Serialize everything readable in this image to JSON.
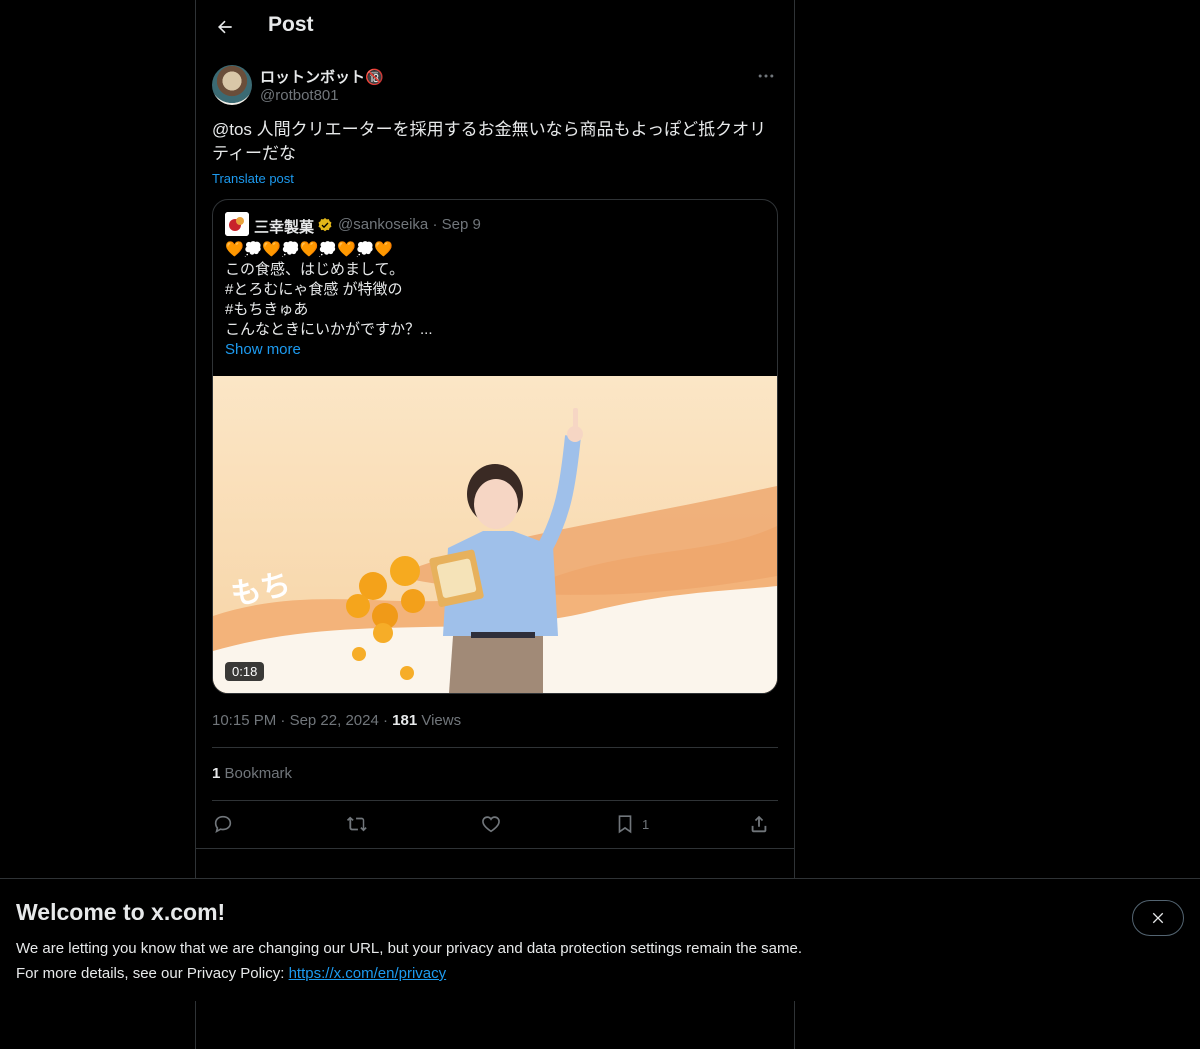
{
  "header": {
    "title": "Post"
  },
  "post": {
    "author_name": "ロットンボット🔞",
    "author_handle": "@rotbot801",
    "text": "@tos 人間クリエーターを採用するお金無いなら商品もよっぽど抵クオリティーだな",
    "translate_label": "Translate post",
    "timestamp_time": "10:15 PM",
    "timestamp_date": "Sep 22, 2024",
    "views_count": "181",
    "views_label": "Views",
    "bookmark_count": "1",
    "bookmark_label": "Bookmark",
    "bookmark_action_count": "1"
  },
  "quote": {
    "name": "三幸製菓",
    "handle": "@sankoseika",
    "date": "Sep 9",
    "lines": [
      "🧡💭🧡💭🧡💭🧡💭🧡",
      "この食感、はじめまして。",
      "#とろむにゃ食感 が特徴の",
      "#もちきゅあ",
      "こんなときにいかがですか？..."
    ],
    "show_more": "Show more",
    "video_duration": "0:18"
  },
  "banner": {
    "title": "Welcome to x.com!",
    "line1": "We are letting you know that we are changing our URL, but your privacy and data protection settings remain the same.",
    "line2_prefix": "For more details, see our Privacy Policy: ",
    "link": "https://x.com/en/privacy"
  },
  "icons": {
    "back": "arrow-left-icon",
    "more": "more-horizontal-icon",
    "verified": "verified-gold-icon",
    "reply": "reply-icon",
    "repost": "repost-icon",
    "like": "heart-icon",
    "bookmark": "bookmark-icon",
    "share": "share-icon",
    "close": "close-icon"
  },
  "colors": {
    "accent": "#1d9bf0",
    "background": "#000000",
    "muted": "#71767b",
    "verified_gold": "#e2b719"
  }
}
